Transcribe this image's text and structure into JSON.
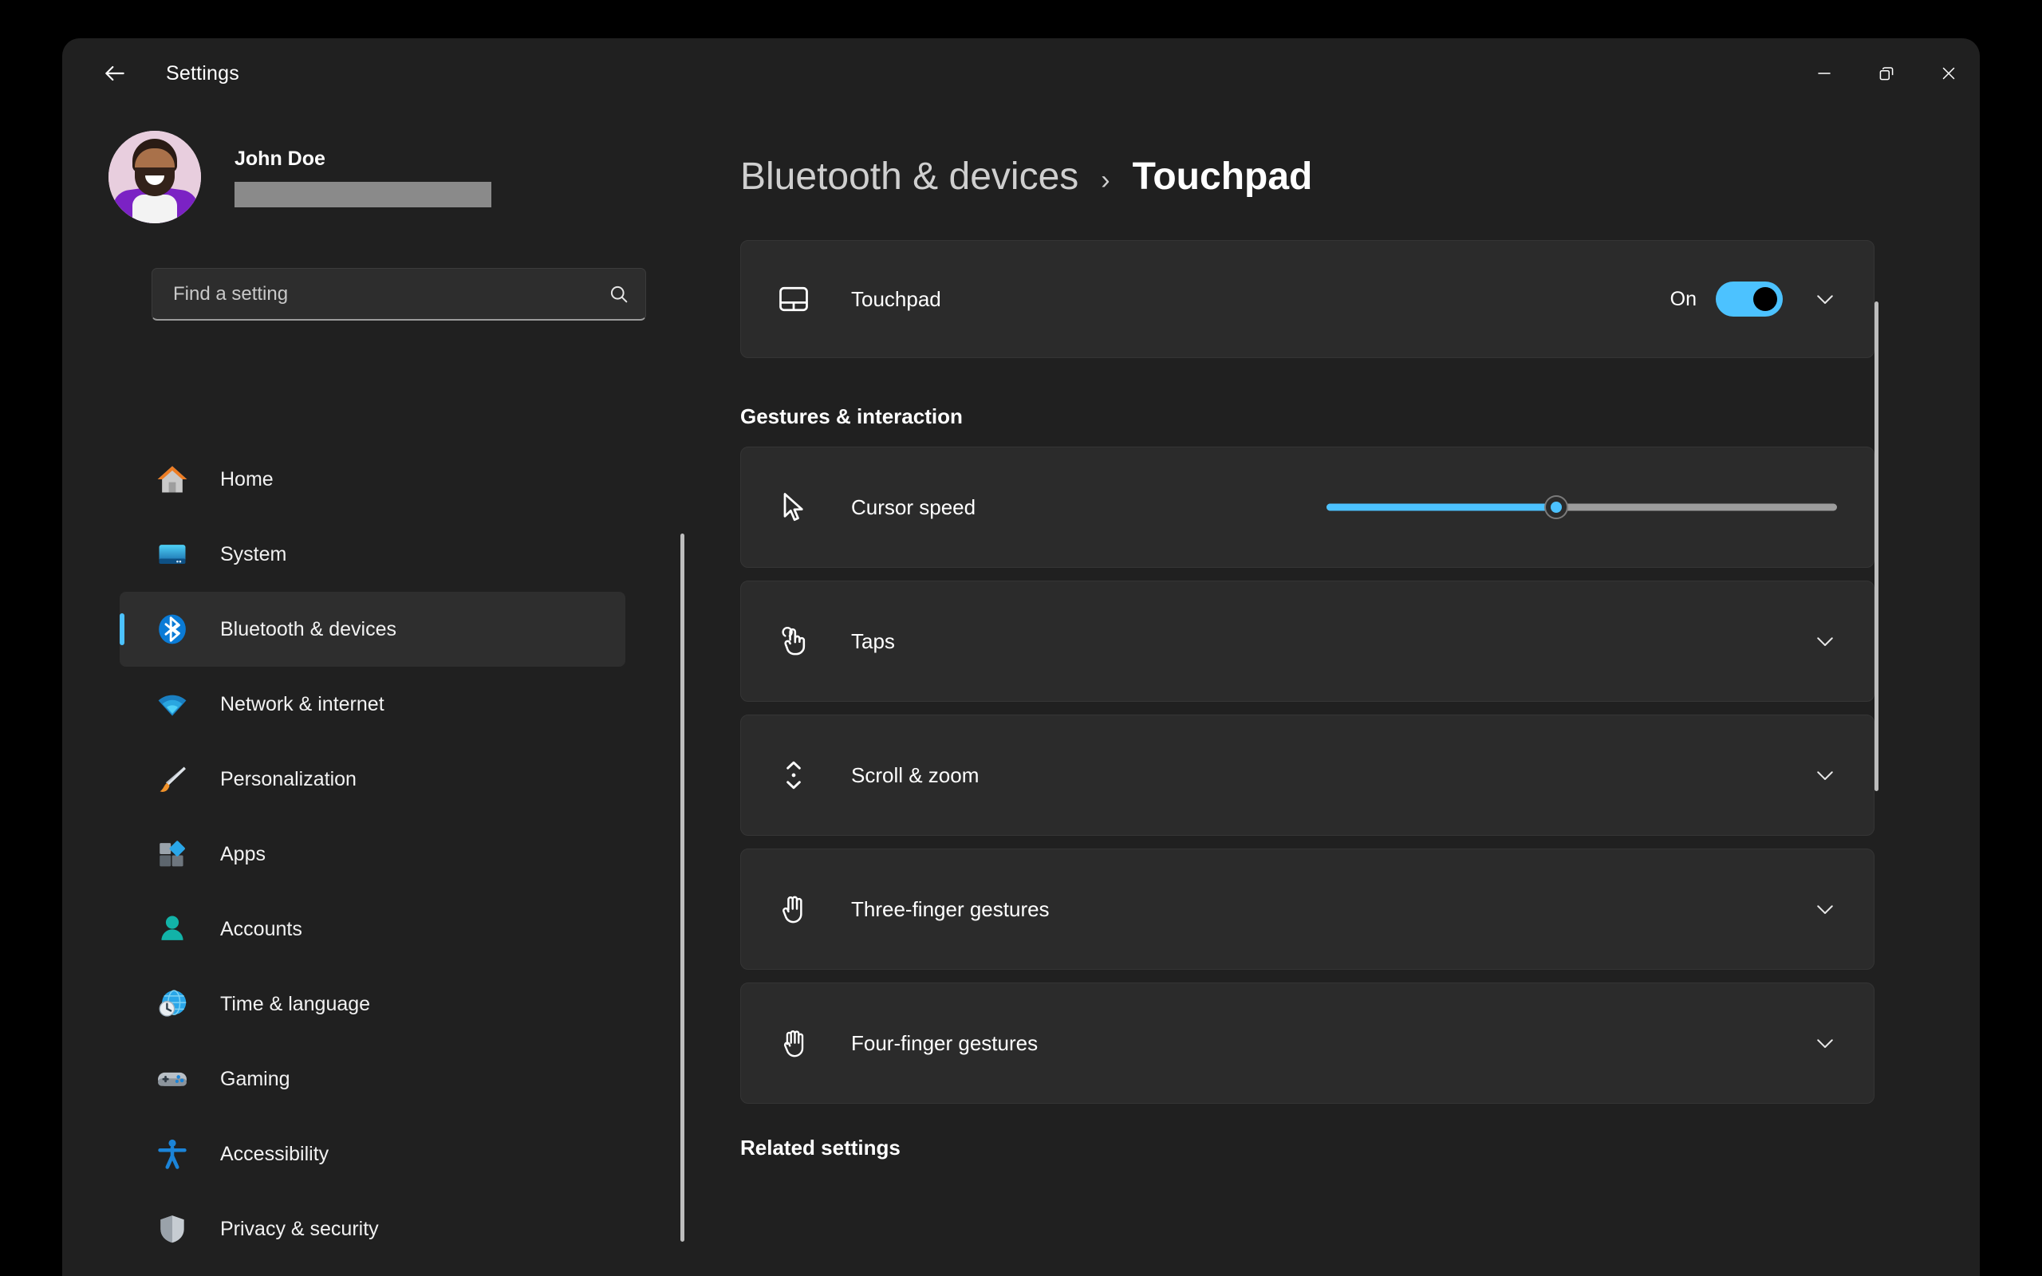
{
  "window": {
    "app_title": "Settings",
    "back_icon": "arrow-left-icon",
    "controls": [
      {
        "name": "minimize",
        "icon": "minimize-icon"
      },
      {
        "name": "restore",
        "icon": "restore-icon"
      },
      {
        "name": "close",
        "icon": "close-icon"
      }
    ]
  },
  "sidebar": {
    "profile": {
      "name": "John Doe",
      "email_redacted": true,
      "avatar": "user-avatar"
    },
    "search": {
      "placeholder": "Find a setting",
      "value": "",
      "icon": "search-icon"
    },
    "items": [
      {
        "label": "Home",
        "icon": "home-icon",
        "selected": false
      },
      {
        "label": "System",
        "icon": "system-icon",
        "selected": false
      },
      {
        "label": "Bluetooth & devices",
        "icon": "bluetooth-icon",
        "selected": true
      },
      {
        "label": "Network & internet",
        "icon": "wifi-icon",
        "selected": false
      },
      {
        "label": "Personalization",
        "icon": "paintbrush-icon",
        "selected": false
      },
      {
        "label": "Apps",
        "icon": "apps-icon",
        "selected": false
      },
      {
        "label": "Accounts",
        "icon": "person-icon",
        "selected": false
      },
      {
        "label": "Time & language",
        "icon": "clock-globe-icon",
        "selected": false
      },
      {
        "label": "Gaming",
        "icon": "gamepad-icon",
        "selected": false
      },
      {
        "label": "Accessibility",
        "icon": "accessibility-icon",
        "selected": false
      },
      {
        "label": "Privacy & security",
        "icon": "shield-icon",
        "selected": false
      }
    ]
  },
  "main": {
    "breadcrumb": {
      "parent": "Bluetooth & devices",
      "separator": "›",
      "current": "Touchpad"
    },
    "touchpad_card": {
      "icon": "touchpad-icon",
      "label": "Touchpad",
      "toggle_state": "On",
      "toggle_on": true,
      "expand_icon": "chevron-down-icon"
    },
    "section_title": "Gestures & interaction",
    "rows": [
      {
        "label": "Cursor speed",
        "icon": "cursor-icon",
        "control": "slider",
        "slider_percent": 45,
        "expand_icon": ""
      },
      {
        "label": "Taps",
        "icon": "tap-hand-icon",
        "control": "expander",
        "expand_icon": "chevron-down-icon"
      },
      {
        "label": "Scroll & zoom",
        "icon": "scroll-icon",
        "control": "expander",
        "expand_icon": "chevron-down-icon"
      },
      {
        "label": "Three-finger gestures",
        "icon": "three-finger-hand-icon",
        "control": "expander",
        "expand_icon": "chevron-down-icon"
      },
      {
        "label": "Four-finger gestures",
        "icon": "four-finger-hand-icon",
        "control": "expander",
        "expand_icon": "chevron-down-icon"
      }
    ],
    "related_title": "Related settings"
  },
  "colors": {
    "accent": "#4cc2ff",
    "window_bg": "#202020",
    "card_bg": "#2b2b2b",
    "selected_nav_bg": "#2e2e2e",
    "text_primary": "#ffffff",
    "text_secondary": "#cfcfcf"
  }
}
